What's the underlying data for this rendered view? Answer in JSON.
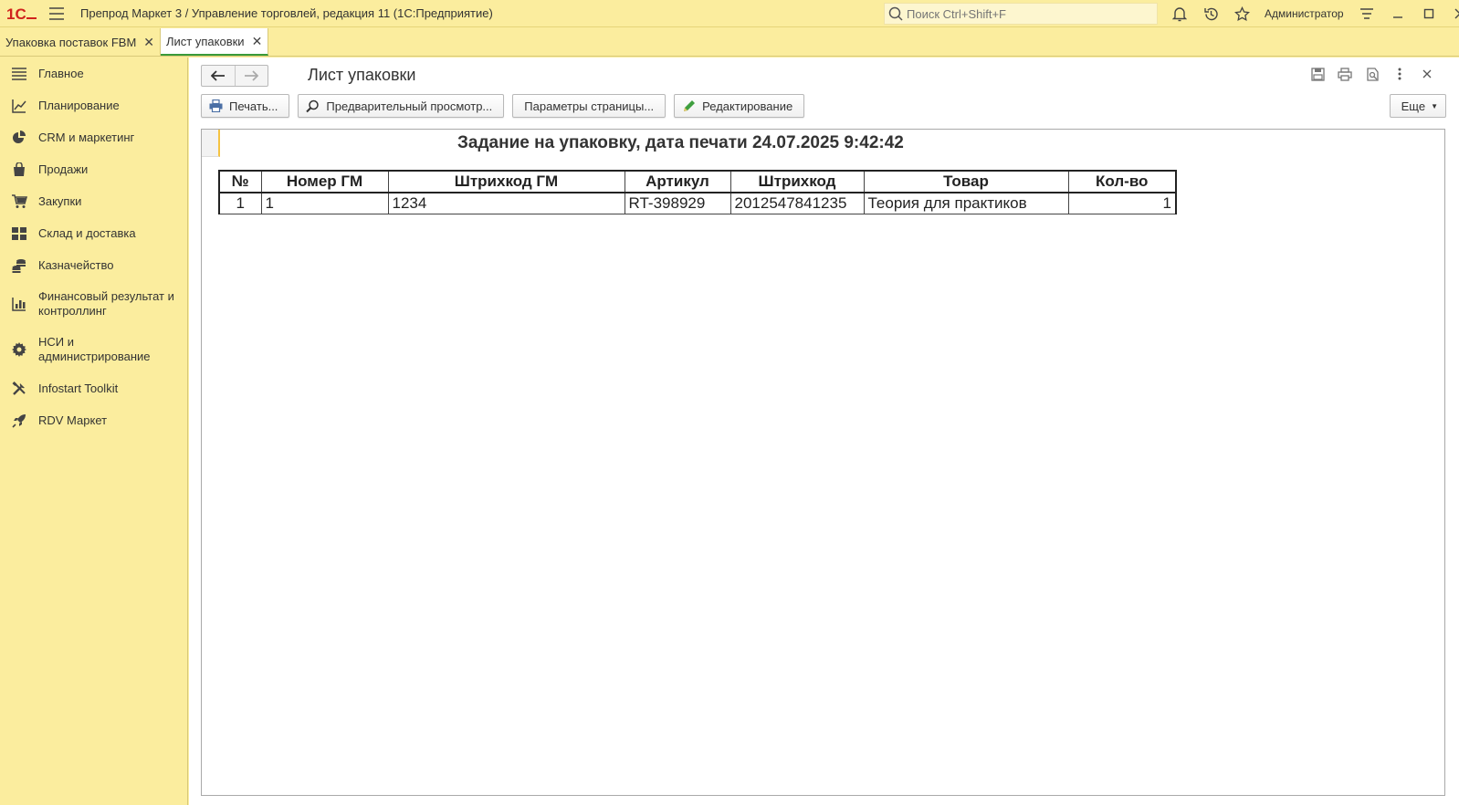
{
  "app": {
    "title": "Препрод Маркет 3 / Управление торговлей, редакция 11  (1С:Предприятие)",
    "search_placeholder": "Поиск Ctrl+Shift+F",
    "user": "Администратор",
    "logo_text": "1С"
  },
  "tabs": [
    {
      "label": "Упаковка поставок FBM",
      "active": false
    },
    {
      "label": "Лист упаковки",
      "active": true
    }
  ],
  "sidebar": {
    "items": [
      {
        "label": "Главное",
        "icon": "menu-lines-icon"
      },
      {
        "label": "Планирование",
        "icon": "chart-up-icon"
      },
      {
        "label": "CRM и маркетинг",
        "icon": "pie-chart-icon"
      },
      {
        "label": "Продажи",
        "icon": "shopping-bag-icon"
      },
      {
        "label": "Закупки",
        "icon": "cart-icon"
      },
      {
        "label": "Склад и доставка",
        "icon": "warehouse-grid-icon"
      },
      {
        "label": "Казначейство",
        "icon": "coins-icon"
      },
      {
        "label": "Финансовый результат и контроллинг",
        "icon": "bar-chart-icon"
      },
      {
        "label": "НСИ и администрирование",
        "icon": "gear-icon"
      },
      {
        "label": "Infostart Toolkit",
        "icon": "tools-icon"
      },
      {
        "label": "RDV Маркет",
        "icon": "rocket-icon"
      }
    ]
  },
  "form": {
    "title": "Лист упаковки",
    "buttons": {
      "print": "Печать...",
      "preview": "Предварительный просмотр...",
      "page_params": "Параметры страницы...",
      "edit": "Редактирование",
      "more": "Еще"
    }
  },
  "document": {
    "heading": "Задание на упаковку, дата печати 24.07.2025 9:42:42",
    "columns": [
      "№",
      "Номер ГМ",
      "Штрихкод ГМ",
      "Артикул",
      "Штрихкод",
      "Товар",
      "Кол-во"
    ],
    "rows": [
      [
        "1",
        "1",
        "1234",
        "RT-398929",
        "2012547841235",
        "Теория для практиков",
        "1"
      ]
    ]
  },
  "colors": {
    "panel_bg": "#fbed9e",
    "logo_red": "#d0231d",
    "active_tab_underline": "#3a9a3a",
    "cell_marker": "#f5c342"
  }
}
